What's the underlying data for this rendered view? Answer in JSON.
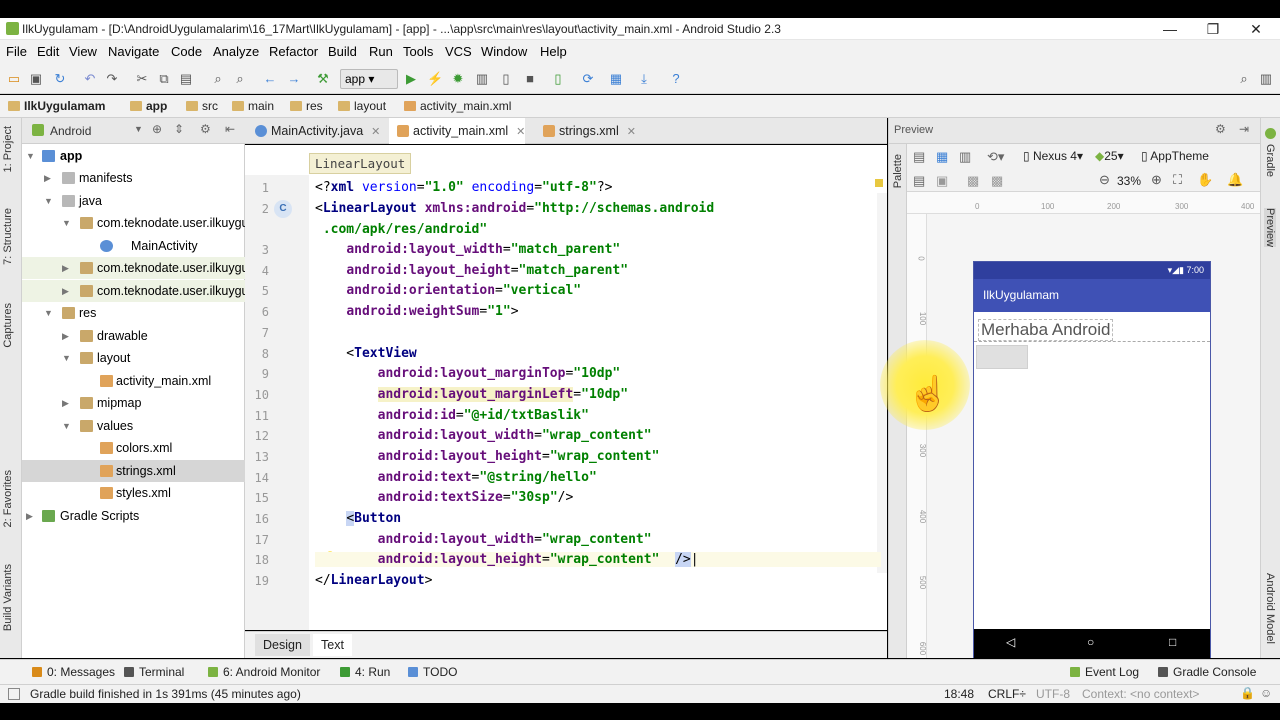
{
  "window": {
    "title": "IlkUygulamam - [D:\\AndroidUygulamalarim\\16_17Mart\\IlkUygulamam] - [app] - ...\\app\\src\\main\\res\\layout\\activity_main.xml - Android Studio 2.3",
    "min": "—",
    "max": "❐",
    "close": "✕"
  },
  "menu": [
    "File",
    "Edit",
    "View",
    "Navigate",
    "Code",
    "Analyze",
    "Refactor",
    "Build",
    "Run",
    "Tools",
    "VCS",
    "Window",
    "Help"
  ],
  "toolbar": {
    "run_config": "app"
  },
  "breadcrumb": [
    "IlkUygulamam",
    "app",
    "src",
    "main",
    "res",
    "layout",
    "activity_main.xml"
  ],
  "left_tabs": {
    "project": "1: Project",
    "structure": "7: Structure",
    "captures": "Captures",
    "favorites": "2: Favorites",
    "variants": "Build Variants"
  },
  "project": {
    "view": "Android",
    "tree": [
      {
        "label": "app",
        "bold": true
      },
      {
        "label": "manifests"
      },
      {
        "label": "java"
      },
      {
        "label": "com.teknodate.user.ilkuygulamam"
      },
      {
        "label": "MainActivity"
      },
      {
        "label": "com.teknodate.user.ilkuygulamam"
      },
      {
        "label": "com.teknodate.user.ilkuygulamam"
      },
      {
        "label": "res"
      },
      {
        "label": "drawable"
      },
      {
        "label": "layout"
      },
      {
        "label": "activity_main.xml"
      },
      {
        "label": "mipmap"
      },
      {
        "label": "values"
      },
      {
        "label": "colors.xml"
      },
      {
        "label": "strings.xml"
      },
      {
        "label": "styles.xml"
      },
      {
        "label": "Gradle Scripts"
      }
    ]
  },
  "tabs": [
    "MainActivity.java",
    "activity_main.xml",
    "strings.xml"
  ],
  "editor": {
    "hint": "LinearLayout",
    "lines": [
      "1",
      "2",
      "",
      "3",
      "4",
      "5",
      "6",
      "7",
      "8",
      "9",
      "10",
      "11",
      "12",
      "13",
      "14",
      "15",
      "16",
      "17",
      "18",
      "19"
    ]
  },
  "editor_tabs": {
    "design": "Design",
    "text": "Text"
  },
  "preview": {
    "title": "Preview",
    "palette": "Palette",
    "device": "Nexus 4",
    "api": "25",
    "theme": "AppTheme",
    "zoom": "33%",
    "ruler_h": [
      "0",
      "100",
      "200",
      "300",
      "400"
    ],
    "ruler_v": [
      "0",
      "100",
      "200",
      "300",
      "400",
      "500",
      "600"
    ],
    "status_time": "7:00",
    "app_title": "IlkUygulamam",
    "hello_text": "Merhaba Android"
  },
  "right_tabs": {
    "gradle": "Gradle",
    "preview": "Preview",
    "model": "Android Model"
  },
  "tool_windows": [
    "0: Messages",
    "Terminal",
    "6: Android Monitor",
    "4: Run",
    "TODO"
  ],
  "tool_windows_right": [
    "Event Log",
    "Gradle Console"
  ],
  "status": {
    "message": "Gradle build finished in 1s 391ms (45 minutes ago)",
    "position": "18:48",
    "line_sep": "CRLF÷",
    "encoding": "UTF-8",
    "context": "Context: <no context>"
  }
}
